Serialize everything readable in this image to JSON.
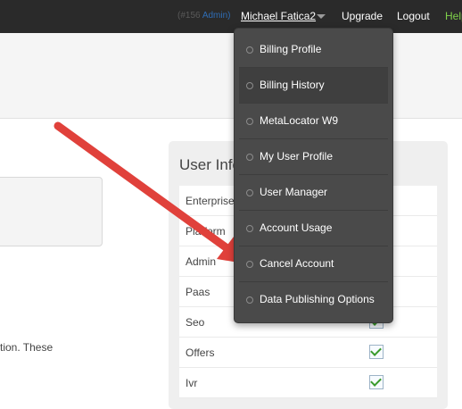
{
  "topbar": {
    "account_id": "(#156",
    "account_role": "Admin)",
    "user_name": "Michael Fatica2",
    "upgrade": "Upgrade",
    "logout": "Logout",
    "help": "Help"
  },
  "content": {
    "body_text": "tion.  These"
  },
  "user_info": {
    "title": "User Info",
    "rows": [
      {
        "label": "Enterprise",
        "checked": false
      },
      {
        "label": "Platform",
        "checked": false
      },
      {
        "label": "Admin",
        "checked": false
      },
      {
        "label": "Paas",
        "checked": false
      },
      {
        "label": "Seo",
        "checked": true
      },
      {
        "label": "Offers",
        "checked": true
      },
      {
        "label": "Ivr",
        "checked": true
      }
    ]
  },
  "menu": {
    "items": [
      {
        "label": "Billing Profile"
      },
      {
        "label": "Billing History",
        "hover": true
      },
      {
        "label": "MetaLocator W9"
      },
      {
        "label": "My User Profile"
      },
      {
        "label": "User Manager"
      },
      {
        "label": "Account Usage"
      },
      {
        "label": "Cancel Account"
      },
      {
        "label": "Data Publishing Options"
      }
    ]
  },
  "colors": {
    "topbar_bg": "#2a2a2a",
    "menu_bg": "#4a4a4a",
    "arrow": "#e0413b",
    "help_link": "#7fd14a",
    "admin_role": "#2f6db5"
  }
}
